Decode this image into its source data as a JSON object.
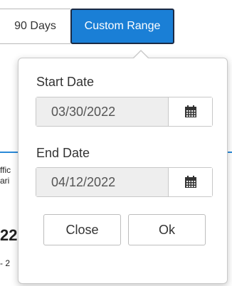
{
  "range_tabs": {
    "days90_label": "90 Days",
    "custom_label": "Custom Range"
  },
  "background_fragments": {
    "line1": "ffic",
    "line2": "ari",
    "big": "22",
    "line4": "- 2"
  },
  "date_picker": {
    "start_label": "Start Date",
    "start_value": "03/30/2022",
    "end_label": "End Date",
    "end_value": "04/12/2022",
    "calendar_icon": "calendar-icon",
    "close_label": "Close",
    "ok_label": "Ok"
  },
  "colors": {
    "accent": "#1a7fd6",
    "accent_border": "#1b2a44",
    "input_bg": "#eeeeee"
  }
}
